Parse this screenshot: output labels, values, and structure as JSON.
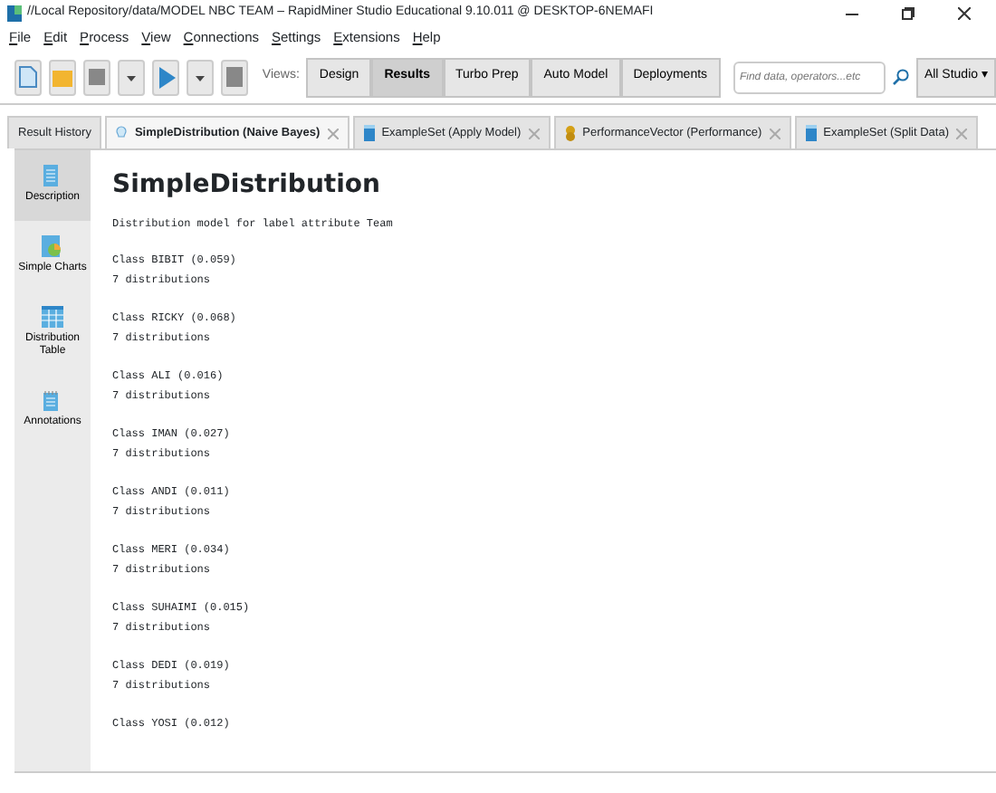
{
  "window": {
    "title": "//Local Repository/data/MODEL NBC TEAM – RapidMiner Studio Educational 9.10.011 @ DESKTOP-6NEMAFI"
  },
  "menu": [
    "File",
    "Edit",
    "Process",
    "View",
    "Connections",
    "Settings",
    "Extensions",
    "Help"
  ],
  "views": {
    "label": "Views:",
    "items": [
      {
        "label": "Design",
        "selected": false
      },
      {
        "label": "Results",
        "selected": true
      },
      {
        "label": "Turbo Prep",
        "selected": false
      },
      {
        "label": "Auto Model",
        "selected": false
      },
      {
        "label": "Deployments",
        "selected": false
      }
    ]
  },
  "search": {
    "placeholder": "Find data, operators...etc",
    "scope": "All Studio ▾"
  },
  "tabs": [
    {
      "label": "Result History",
      "kind": "plain",
      "selected": false
    },
    {
      "label": "SimpleDistribution (Naive Bayes)",
      "kind": "bulb",
      "selected": true
    },
    {
      "label": "ExampleSet (Apply Model)",
      "kind": "table",
      "selected": false
    },
    {
      "label": "PerformanceVector (Performance)",
      "kind": "coins",
      "selected": false
    },
    {
      "label": "ExampleSet (Split Data)",
      "kind": "table",
      "selected": false
    }
  ],
  "sidebar": [
    {
      "label": "Description",
      "kind": "doc",
      "selected": true
    },
    {
      "label": "Simple Charts",
      "kind": "chart",
      "selected": false
    },
    {
      "label": "Distribution Table",
      "kind": "grid",
      "selected": false
    },
    {
      "label": "Annotations",
      "kind": "notes",
      "selected": false
    }
  ],
  "content": {
    "heading": "SimpleDistribution",
    "subtitle": "Distribution model for label attribute Team",
    "classes": [
      {
        "name": "Class BIBIT (0.059)",
        "detail": "7 distributions"
      },
      {
        "name": "Class RICKY (0.068)",
        "detail": "7 distributions"
      },
      {
        "name": "Class ALI (0.016)",
        "detail": "7 distributions"
      },
      {
        "name": "Class IMAN (0.027)",
        "detail": "7 distributions"
      },
      {
        "name": "Class ANDI (0.011)",
        "detail": "7 distributions"
      },
      {
        "name": "Class MERI (0.034)",
        "detail": "7 distributions"
      },
      {
        "name": "Class SUHAIMI (0.015)",
        "detail": "7 distributions"
      },
      {
        "name": "Class DEDI (0.019)",
        "detail": "7 distributions"
      },
      {
        "name": "Class YOSI (0.012)"
      }
    ]
  }
}
